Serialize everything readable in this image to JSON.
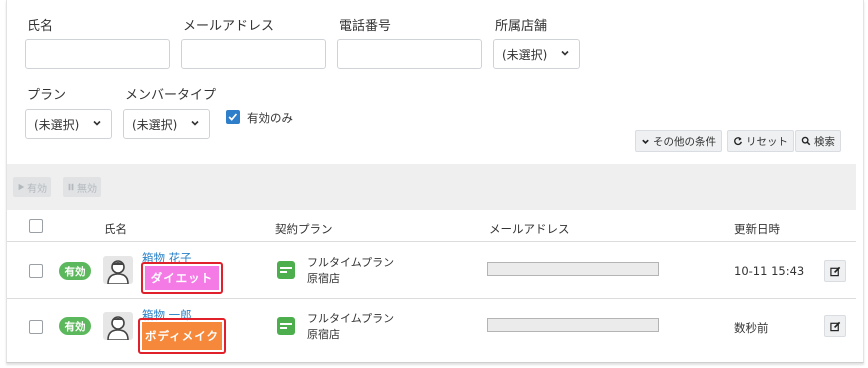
{
  "filters": {
    "name_label": "氏名",
    "email_label": "メールアドレス",
    "phone_label": "電話番号",
    "store_label": "所属店舗",
    "store_value": "(未選択)",
    "plan_label": "プラン",
    "plan_value": "(未選択)",
    "member_type_label": "メンバータイプ",
    "member_type_value": "(未選択)",
    "active_only_label": "有効のみ",
    "active_only_checked": true,
    "name_value": "",
    "email_value": "",
    "phone_value": ""
  },
  "toolbar": {
    "other_conditions": "その他の条件",
    "reset": "リセット",
    "search": "検索"
  },
  "actions": {
    "activate": "有効",
    "deactivate": "無効"
  },
  "table": {
    "headers": [
      "氏名",
      "契約プラン",
      "メールアドレス",
      "更新日時"
    ],
    "rows": [
      {
        "status": "有効",
        "name": "箱物 花子",
        "tag": "ダイエット",
        "tag_color": "#f47be6",
        "plan": "フルタイムプラン",
        "store": "原宿店",
        "updated": "10-11 15:43"
      },
      {
        "status": "有効",
        "name": "箱物 一郎",
        "tag": "ボディメイク",
        "tag_color": "#f5883a",
        "plan": "フルタイムプラン",
        "store": "原宿店",
        "updated": "数秒前"
      }
    ]
  },
  "colors": {
    "active_green": "#5cb85c",
    "link_blue": "#2a82c7",
    "highlight_red": "#e0202a"
  }
}
